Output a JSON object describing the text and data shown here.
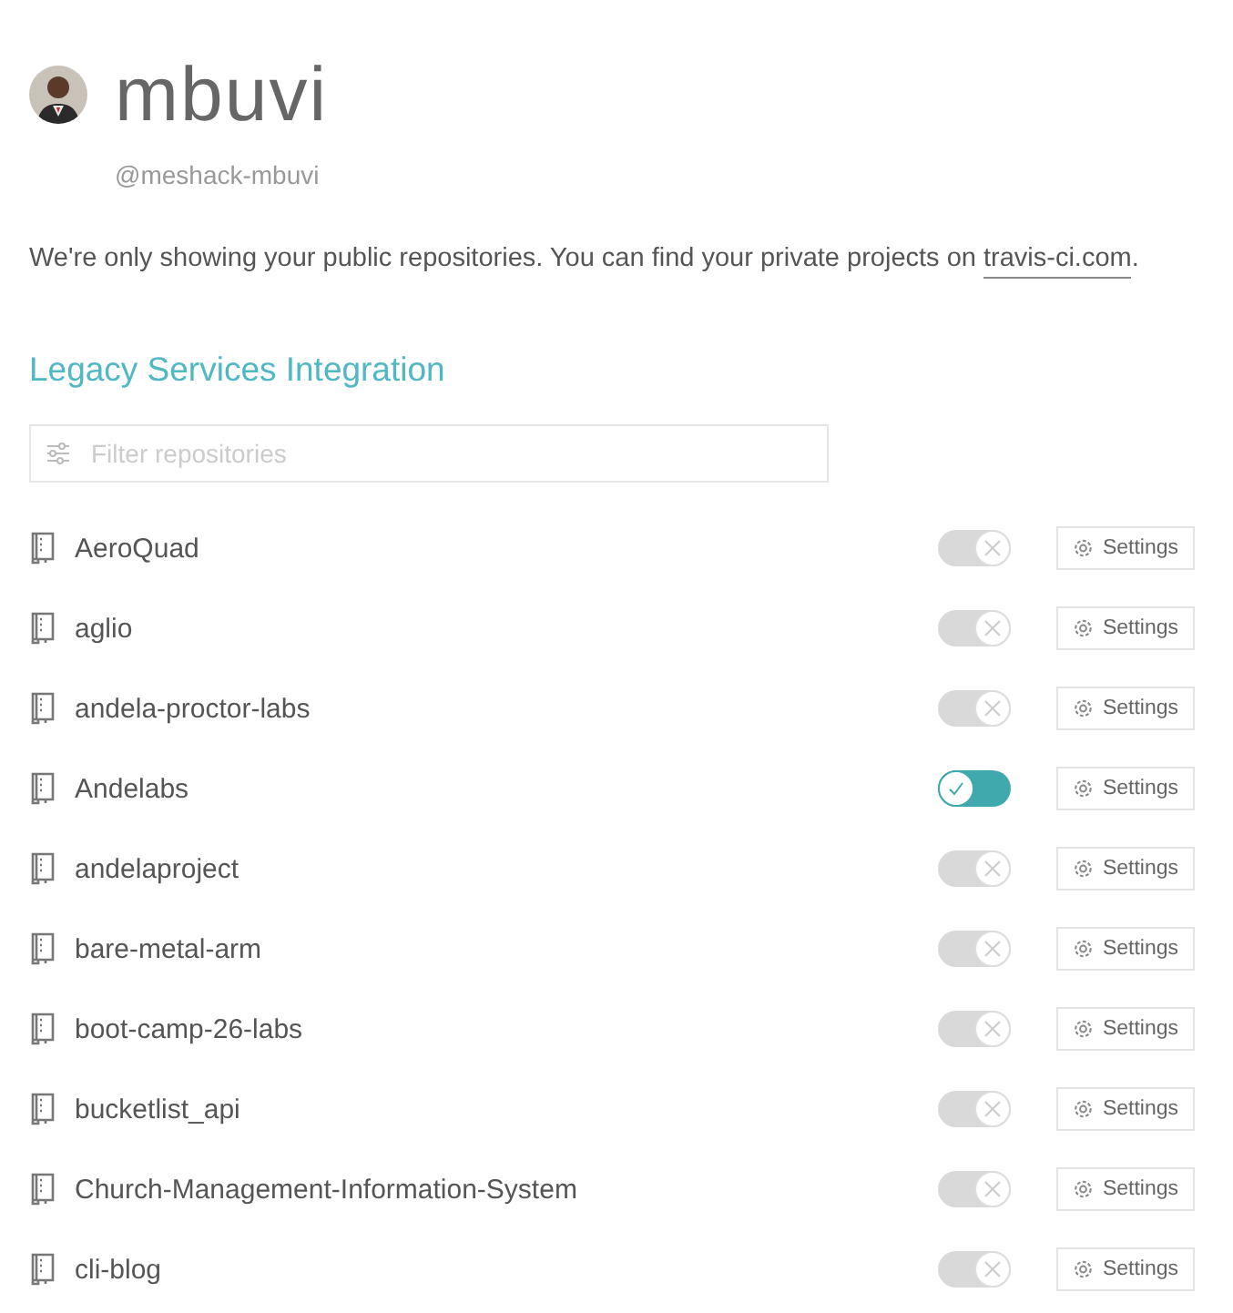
{
  "profile": {
    "name": "mbuvi",
    "handle": "@meshack-mbuvi"
  },
  "notice": {
    "text": "We're only showing your public repositories. You can find your private projects on ",
    "link": "travis-ci.com",
    "end": "."
  },
  "section_title": "Legacy Services Integration",
  "filter": {
    "placeholder": "Filter repositories"
  },
  "repositories": [
    {
      "name": "AeroQuad",
      "on": false,
      "settings": "Settings"
    },
    {
      "name": "aglio",
      "on": false,
      "settings": "Settings"
    },
    {
      "name": "andela-proctor-labs",
      "on": false,
      "settings": "Settings"
    },
    {
      "name": "Andelabs",
      "on": true,
      "settings": "Settings"
    },
    {
      "name": "andelaproject",
      "on": false,
      "settings": "Settings"
    },
    {
      "name": "bare-metal-arm",
      "on": false,
      "settings": "Settings"
    },
    {
      "name": "boot-camp-26-labs",
      "on": false,
      "settings": "Settings"
    },
    {
      "name": "bucketlist_api",
      "on": false,
      "settings": "Settings"
    },
    {
      "name": "Church-Management-Information-System",
      "on": false,
      "settings": "Settings"
    },
    {
      "name": "cli-blog",
      "on": false,
      "settings": "Settings"
    }
  ]
}
